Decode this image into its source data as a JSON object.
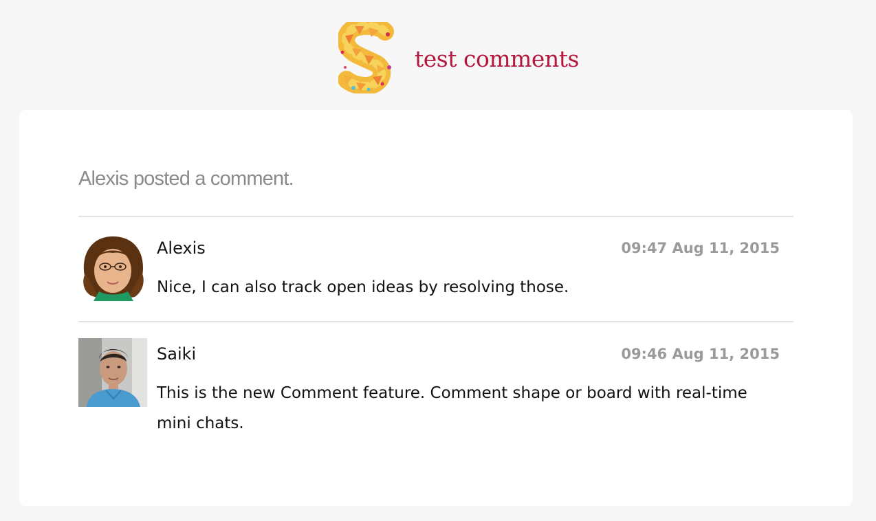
{
  "header": {
    "board_title": "test comments",
    "logo_icon": "s-logo-icon",
    "title_color": "#b5183d"
  },
  "notification": {
    "summary": "Alexis posted a comment."
  },
  "comments": [
    {
      "author": "Alexis",
      "timestamp": "09:47 Aug 11, 2015",
      "text": "Nice, I can also track open ideas by resolving those."
    },
    {
      "author": "Saiki",
      "timestamp": "09:46 Aug 11, 2015",
      "text": "This is the new Comment feature. Comment shape or board with real-time mini chats."
    }
  ]
}
